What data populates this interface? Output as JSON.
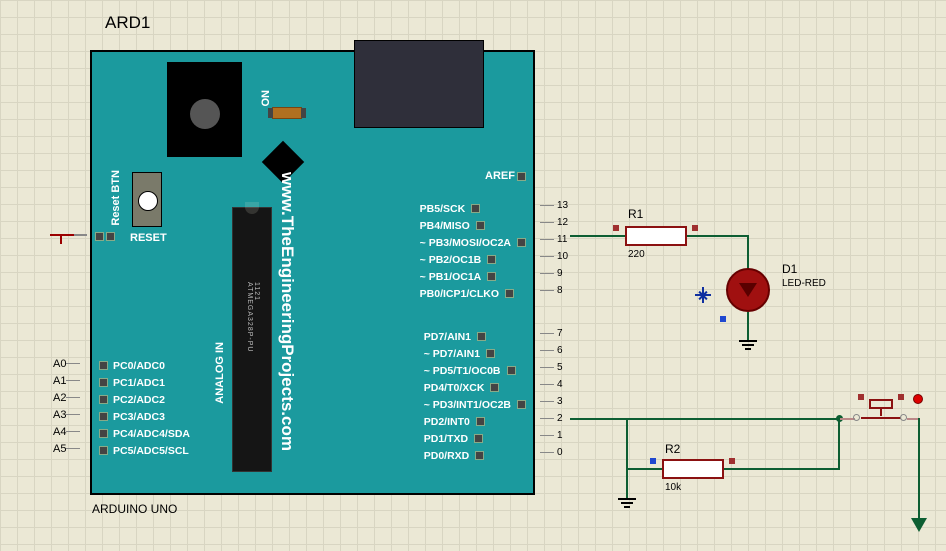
{
  "designator": "ARD1",
  "board_name": "ARDUINO UNO",
  "url_text": "www.TheEngineeringProjects.com",
  "reset_btn": "Reset BTN",
  "reset_pin": "RESET",
  "on_label": "ON",
  "analog_in": "ANALOG IN",
  "chip_marking": "ATMEGA328P-PU",
  "chip_code": "1121",
  "aref": "AREF",
  "analog_ext": [
    "A0",
    "A1",
    "A2",
    "A3",
    "A4",
    "A5"
  ],
  "analog_pins": [
    "PC0/ADC0",
    "PC1/ADC1",
    "PC2/ADC2",
    "PC3/ADC3",
    "PC4/ADC4/SDA",
    "PC5/ADC5/SCL"
  ],
  "digital_high": [
    {
      "n": "13",
      "l": "PB5/SCK"
    },
    {
      "n": "12",
      "l": "PB4/MISO"
    },
    {
      "n": "11",
      "l": "~ PB3/MOSI/OC2A"
    },
    {
      "n": "10",
      "l": "~ PB2/OC1B"
    },
    {
      "n": "9",
      "l": "~ PB1/OC1A"
    },
    {
      "n": "8",
      "l": "PB0/ICP1/CLKO"
    }
  ],
  "digital_low": [
    {
      "n": "7",
      "l": "PD7/AIN1"
    },
    {
      "n": "6",
      "l": "~ PD7/AIN1"
    },
    {
      "n": "5",
      "l": "~ PD5/T1/OC0B"
    },
    {
      "n": "4",
      "l": "PD4/T0/XCK"
    },
    {
      "n": "3",
      "l": "~ PD3/INT1/OC2B"
    },
    {
      "n": "2",
      "l": "PD2/INT0"
    },
    {
      "n": "1",
      "l": "PD1/TXD"
    },
    {
      "n": "0",
      "l": "PD0/RXD"
    }
  ],
  "components": {
    "R1": {
      "name": "R1",
      "value": "220"
    },
    "R2": {
      "name": "R2",
      "value": "10k"
    },
    "D1": {
      "name": "D1",
      "value": "LED-RED"
    }
  }
}
